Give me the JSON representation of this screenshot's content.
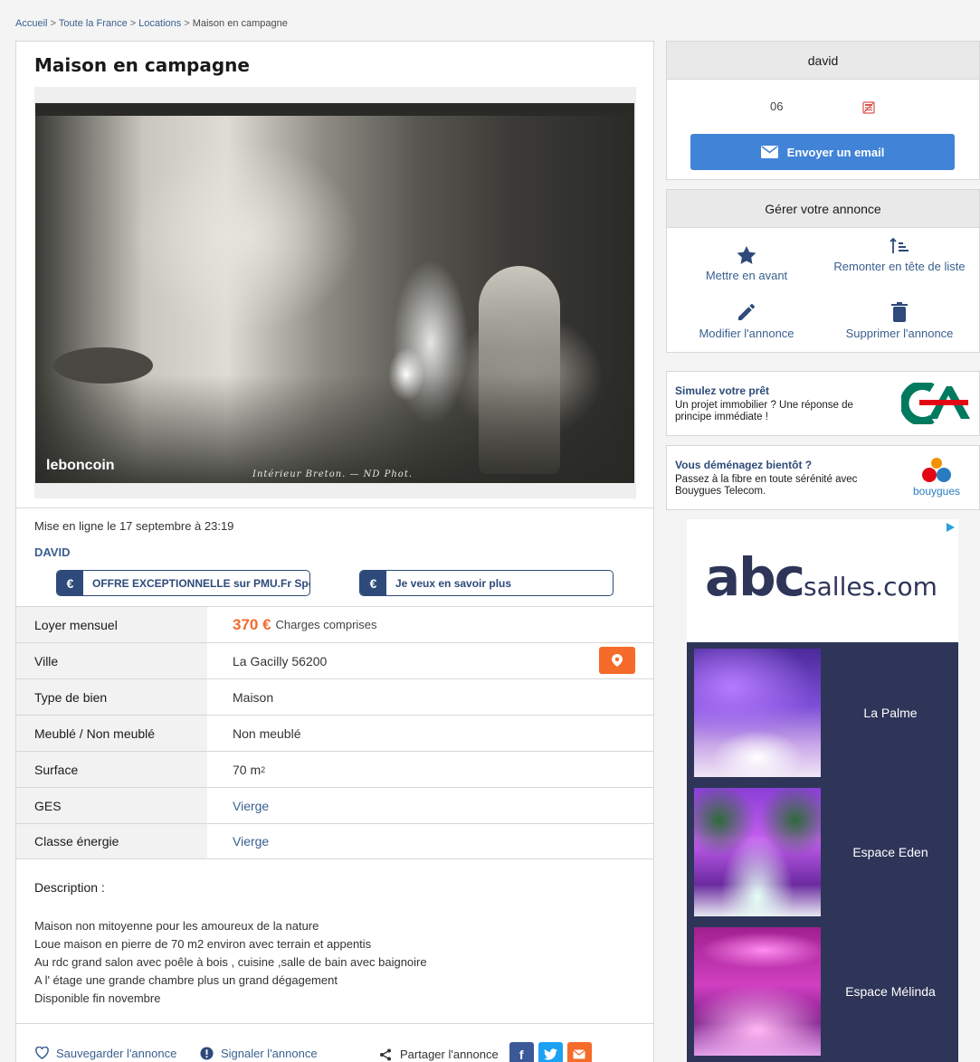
{
  "breadcrumb": {
    "items": [
      "Accueil",
      "Toute la France",
      "Locations"
    ],
    "current": "Maison en campagne",
    "separator": ">"
  },
  "listing": {
    "title": "Maison en campagne",
    "photo": {
      "watermark": "leboncoin",
      "caption": "Intérieur Breton. — ND Phot."
    },
    "posted": "Mise en ligne le 17 septembre à 23:19",
    "seller": "DAVID",
    "offers": [
      {
        "icon": "€",
        "label": "OFFRE EXCEPTIONNELLE sur PMU.Fr Spo"
      },
      {
        "icon": "€",
        "label": "Je veux en savoir plus"
      }
    ],
    "attributes": [
      {
        "key": "Loyer mensuel",
        "price": "370 €",
        "note": "Charges comprises"
      },
      {
        "key": "Ville",
        "value": "La Gacilly 56200"
      },
      {
        "key": "Type de bien",
        "value": "Maison"
      },
      {
        "key": "Meublé / Non meublé",
        "value": "Non meublé"
      },
      {
        "key": "Surface",
        "value": "70 m",
        "sup": "2"
      },
      {
        "key": "GES",
        "value": "Vierge"
      },
      {
        "key": "Classe énergie",
        "value": "Vierge"
      }
    ],
    "description_title": "Description :",
    "description_lines": [
      "Maison non mitoyenne pour les amoureux de la nature",
      "Loue maison en pierre de 70 m2 environ avec terrain et appentis",
      "Au rdc grand salon avec poêle à bois , cuisine ,salle de bain avec baignoire",
      "A l' étage une grande chambre plus un grand dégagement",
      "Disponible fin novembre"
    ],
    "actions": {
      "save": "Sauvegarder l'annonce",
      "report": "Signaler l'annonce",
      "share": "Partager l'annonce"
    }
  },
  "contact": {
    "name": "david",
    "phone": "06",
    "email_button": "Envoyer un email"
  },
  "manage": {
    "title": "Gérer votre annonce",
    "items": [
      {
        "label": "Mettre en avant",
        "icon": "star-icon"
      },
      {
        "label": "Remonter en tête de liste",
        "icon": "sort-up-icon"
      },
      {
        "label": "Modifier l'annonce",
        "icon": "pencil-icon"
      },
      {
        "label": "Supprimer l'annonce",
        "icon": "trash-icon"
      }
    ]
  },
  "promos": [
    {
      "title": "Simulez votre prêt",
      "text": "Un projet immobilier ? Une réponse de principe immédiate !",
      "logo": "CA"
    },
    {
      "title": "Vous déménagez bientôt ?",
      "text": "Passez à la fibre en toute sérénité avec Bouygues Telecom.",
      "logo": "bouygues"
    }
  ],
  "ad": {
    "brand_abc": "abc",
    "brand_salles": "salles.com",
    "venues": [
      "La Palme",
      "Espace Eden",
      "Espace Mélinda"
    ]
  },
  "colors": {
    "accent_orange": "#f56b2a",
    "link_blue": "#3a5f8f",
    "button_blue": "#4183d7",
    "navy": "#2d4a7a",
    "ad_bg": "#2e3559"
  }
}
